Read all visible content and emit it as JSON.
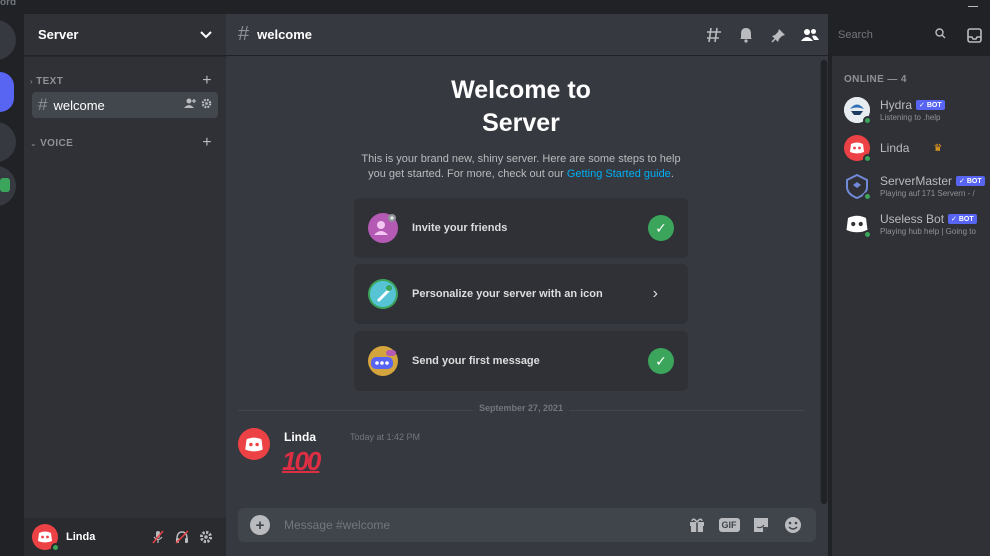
{
  "window": {
    "app_name": "ord"
  },
  "server": {
    "name": "Server"
  },
  "sidebar": {
    "categories": [
      {
        "label": "TEXT"
      },
      {
        "label": "VOICE"
      }
    ],
    "channels": [
      {
        "name": "welcome"
      }
    ]
  },
  "user": {
    "name": "Linda"
  },
  "channel_header": {
    "title": "welcome",
    "search_placeholder": "Search"
  },
  "welcome": {
    "title": "Welcome to\nServer",
    "description": "This is your brand new, shiny server. Here are some steps to help you get started. For more, check out our ",
    "link": "Getting Started guide",
    "period": "."
  },
  "cards": [
    {
      "label": "Invite your friends",
      "done": true,
      "color": "#b45ab4"
    },
    {
      "label": "Personalize your server with an icon",
      "done": false,
      "color": "#3ba55c"
    },
    {
      "label": "Send your first message",
      "done": true,
      "color": "#d4a53c"
    }
  ],
  "divider_date": "September 27, 2021",
  "message": {
    "author": "Linda",
    "time": "Today at 1:42 PM",
    "emoji": "100"
  },
  "composer": {
    "placeholder": "Message #welcome",
    "gif_label": "GIF"
  },
  "members": {
    "heading": "ONLINE — 4",
    "list": [
      {
        "name": "Hydra",
        "bot": true,
        "activity": "Listening to .help",
        "color": "#2f6fb5"
      },
      {
        "name": "Linda",
        "bot": false,
        "activity": "",
        "color": "#ed4245",
        "owner": true
      },
      {
        "name": "ServerMaster",
        "bot": true,
        "activity": "Playing auf 171 Servern - /",
        "color": "#4752c4"
      },
      {
        "name": "Useless Bot",
        "bot": true,
        "activity": "Playing hub help | Going to",
        "color": "#dcddde"
      }
    ],
    "bot_label": "✓ BOT"
  },
  "colors": {
    "accent": "#5865f2",
    "online": "#3ba55c",
    "link": "#00aff4",
    "danger": "#ed4245"
  }
}
